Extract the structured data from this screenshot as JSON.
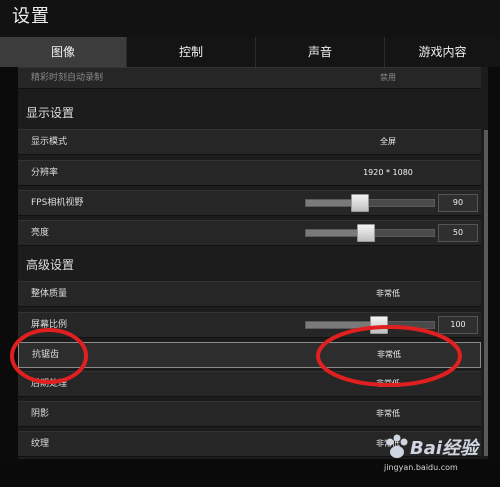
{
  "window": {
    "title": "设置"
  },
  "tabs": [
    {
      "label": "图像",
      "active": true
    },
    {
      "label": "控制",
      "active": false
    },
    {
      "label": "声音",
      "active": false
    },
    {
      "label": "游戏内容",
      "active": false
    }
  ],
  "rows": {
    "highlight_record": {
      "label": "精彩时刻自动录制",
      "value": "禁用"
    },
    "display_mode": {
      "label": "显示模式",
      "value": "全屏"
    },
    "resolution": {
      "label": "分辨率",
      "value": "1920 * 1080"
    },
    "fps_fov": {
      "label": "FPS相机视野",
      "value": "90",
      "slider_fraction": 0.42
    },
    "brightness": {
      "label": "亮度",
      "value": "50",
      "slider_fraction": 0.47
    },
    "overall_quality": {
      "label": "整体质量",
      "value": "非常低"
    },
    "screen_scale": {
      "label": "屏幕比例",
      "value": "100",
      "slider_fraction": 0.57
    },
    "anti_aliasing": {
      "label": "抗锯齿",
      "value": "非常低"
    },
    "post_processing": {
      "label": "后期处理",
      "value": "非常低"
    },
    "shadows": {
      "label": "阴影",
      "value": "非常低"
    },
    "textures": {
      "label": "纹理",
      "value": "非常低"
    }
  },
  "sections": {
    "display": "显示设置",
    "advanced": "高级设置"
  },
  "watermark": {
    "brand": "Bai经验",
    "url": "jingyan.baidu.com"
  },
  "colors": {
    "annotation_circle": "#e02020",
    "active_tab": "#3c3c3c"
  }
}
